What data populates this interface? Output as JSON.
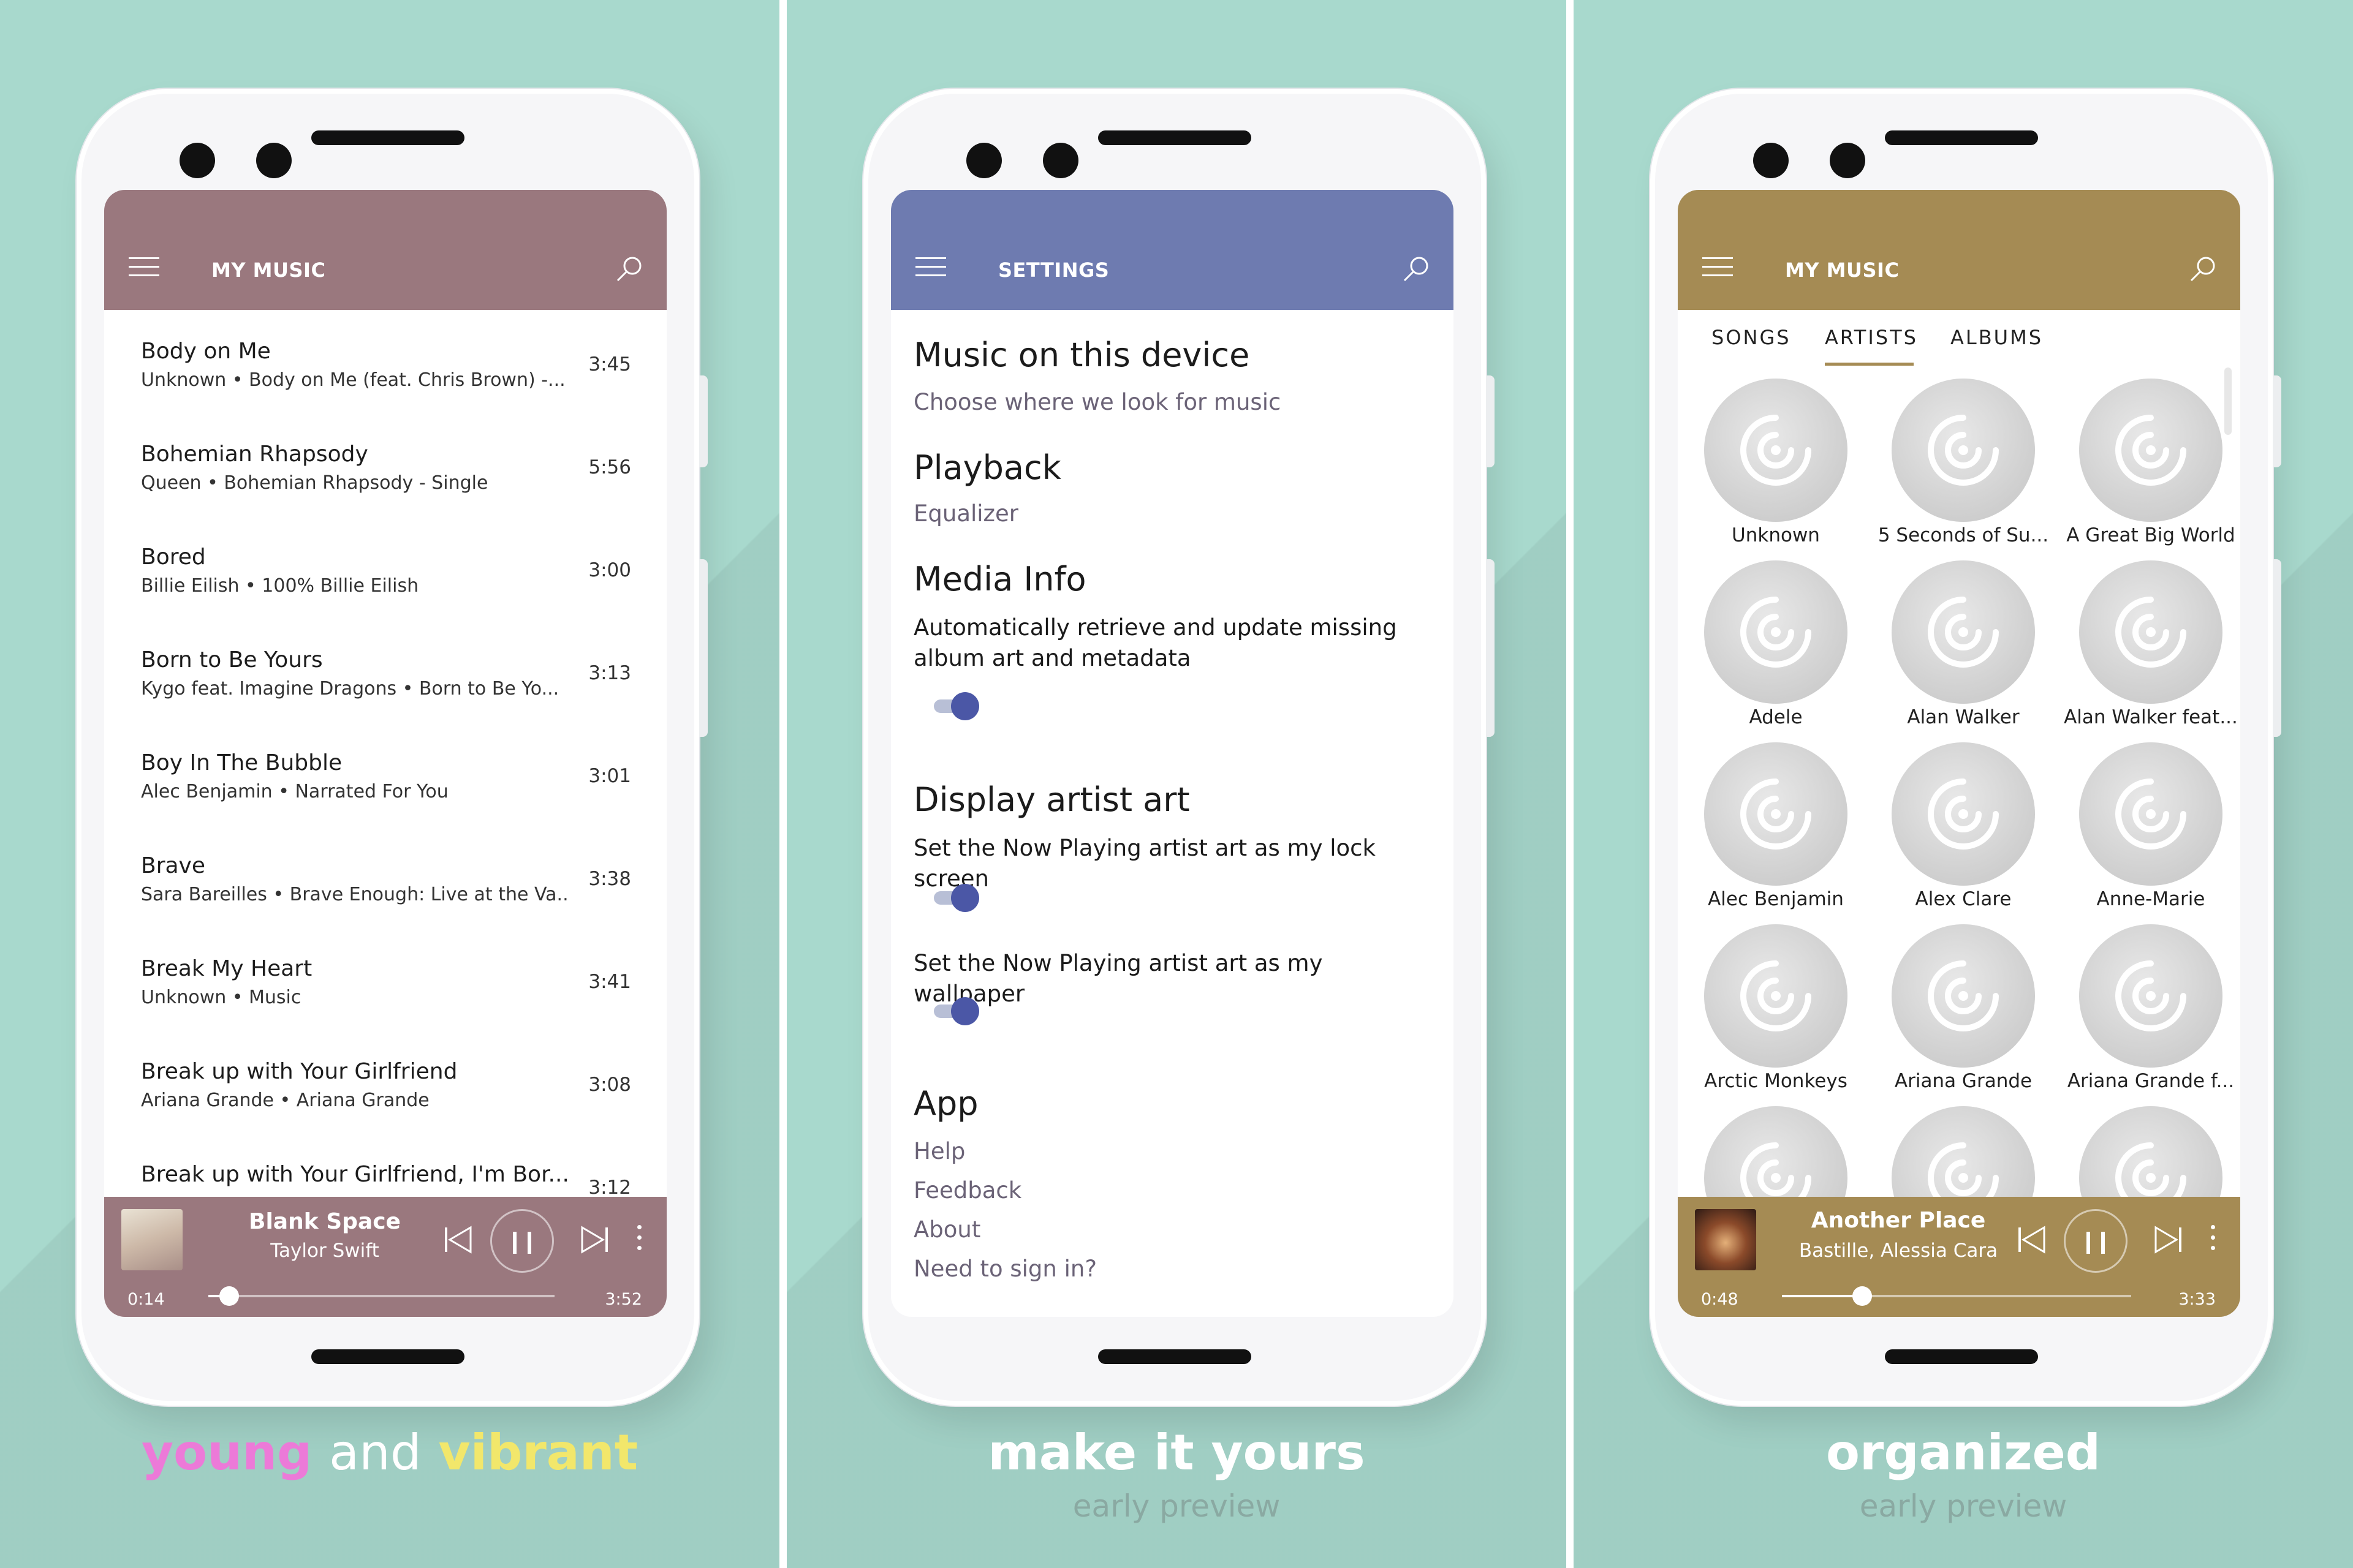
{
  "colors": {
    "background": "#a8d9cd",
    "mauve": "#9a787e",
    "slate_blue": "#6e7bb0",
    "gold": "#a58b54",
    "toggle_knob": "#4b57a6",
    "young_pink": "#ec7ad8",
    "vibrant_yellow": "#f2e76b"
  },
  "panel1": {
    "appbar_title": "MY MUSIC",
    "songs": [
      {
        "title": "Body on Me",
        "subtitle": "Unknown • Body on Me (feat. Chris Brown) -...",
        "duration": "3:45"
      },
      {
        "title": "Bohemian Rhapsody",
        "subtitle": "Queen • Bohemian Rhapsody - Single",
        "duration": "5:56"
      },
      {
        "title": "Bored",
        "subtitle": "Billie Eilish • 100% Billie Eilish",
        "duration": "3:00"
      },
      {
        "title": "Born to Be Yours",
        "subtitle": "Kygo feat. Imagine Dragons • Born to Be Yo...",
        "duration": "3:13"
      },
      {
        "title": "Boy In The Bubble",
        "subtitle": "Alec Benjamin • Narrated For You",
        "duration": "3:01"
      },
      {
        "title": "Brave",
        "subtitle": "Sara Bareilles • Brave Enough: Live at the Va...",
        "duration": "3:38"
      },
      {
        "title": "Break My Heart",
        "subtitle": "Unknown • Music",
        "duration": "3:41"
      },
      {
        "title": "Break up with Your Girlfriend",
        "subtitle": "Ariana Grande • Ariana Grande",
        "duration": "3:08"
      },
      {
        "title": "Break up with Your Girlfriend, I'm Bor...",
        "subtitle": "",
        "duration": "3:12"
      }
    ],
    "now_playing": {
      "title": "Blank Space",
      "artist": "Taylor Swift",
      "elapsed": "0:14",
      "total": "3:52",
      "progress": 0.06
    },
    "caption_words": [
      "young",
      "and",
      "vibrant"
    ]
  },
  "panel2": {
    "appbar_title": "SETTINGS",
    "music_device_heading": "Music on this device",
    "music_device_link": "Choose where we look for music",
    "playback_heading": "Playback",
    "equalizer_link": "Equalizer",
    "media_info_heading": "Media Info",
    "media_info_desc": "Automatically retrieve and update missing album art and metadata",
    "display_art_heading": "Display artist art",
    "lockscreen_desc": "Set the Now Playing artist art as my lock screen",
    "wallpaper_desc": "Set the Now Playing artist art as my wallpaper",
    "app_heading": "App",
    "help_link": "Help",
    "feedback_link": "Feedback",
    "about_link": "About",
    "signin_link": "Need to sign in?",
    "caption": "make it yours",
    "sub_caption": "early preview"
  },
  "panel3": {
    "appbar_title": "MY MUSIC",
    "tabs": [
      "SONGS",
      "ARTISTS",
      "ALBUMS"
    ],
    "active_tab": "ARTISTS",
    "artists": [
      "Unknown",
      "5 Seconds of Su...",
      "A Great Big World",
      "Adele",
      "Alan Walker",
      "Alan Walker feat...",
      "Alec Benjamin",
      "Alex Clare",
      "Anne-Marie",
      "Arctic Monkeys",
      "Ariana Grande",
      "Ariana Grande f...",
      "",
      "",
      ""
    ],
    "now_playing": {
      "title": "Another Place",
      "artist": "Bastille, Alessia Cara",
      "elapsed": "0:48",
      "total": "3:33",
      "progress": 0.23
    },
    "caption": "organized",
    "sub_caption": "early preview"
  }
}
